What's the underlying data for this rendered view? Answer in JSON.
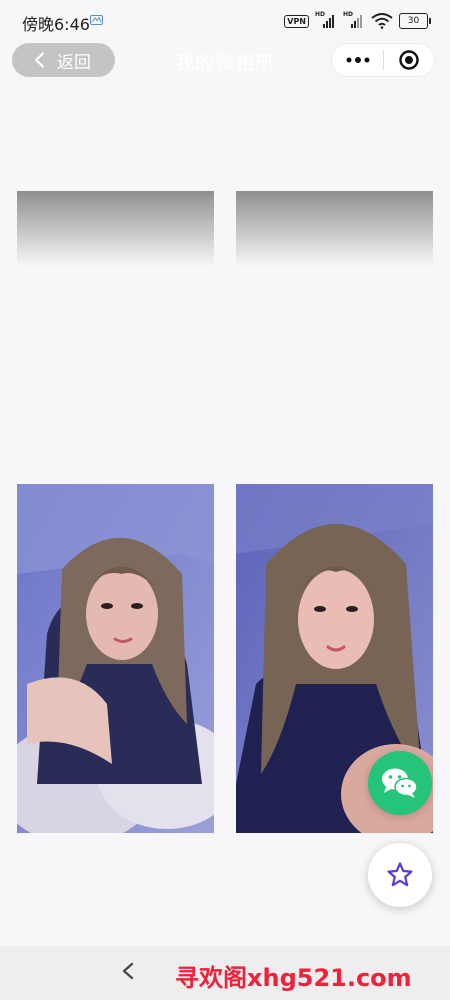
{
  "status_bar": {
    "time": "傍晚6:46",
    "vpn": "VPN",
    "hd_label": "HD",
    "battery": "30"
  },
  "nav": {
    "back_label": "返回",
    "title": "我的微相册",
    "icons": [
      "more-dots-icon",
      "close-target-icon"
    ]
  },
  "gallery": {
    "rows": [
      [
        "gradient-placeholder",
        "gradient-placeholder"
      ],
      [
        "portrait-photo",
        "portrait-photo"
      ]
    ]
  },
  "fabs": [
    "wechat-icon",
    "star-icon"
  ],
  "bottom": {
    "back_icon": "chevron-left-icon",
    "watermark": "寻欢阁xhg521.com"
  },
  "colors": {
    "background": "#f7f7f9",
    "wechat_green": "#26c37b",
    "star_purple": "#5b3bd6",
    "watermark_red": "#f0213b"
  }
}
